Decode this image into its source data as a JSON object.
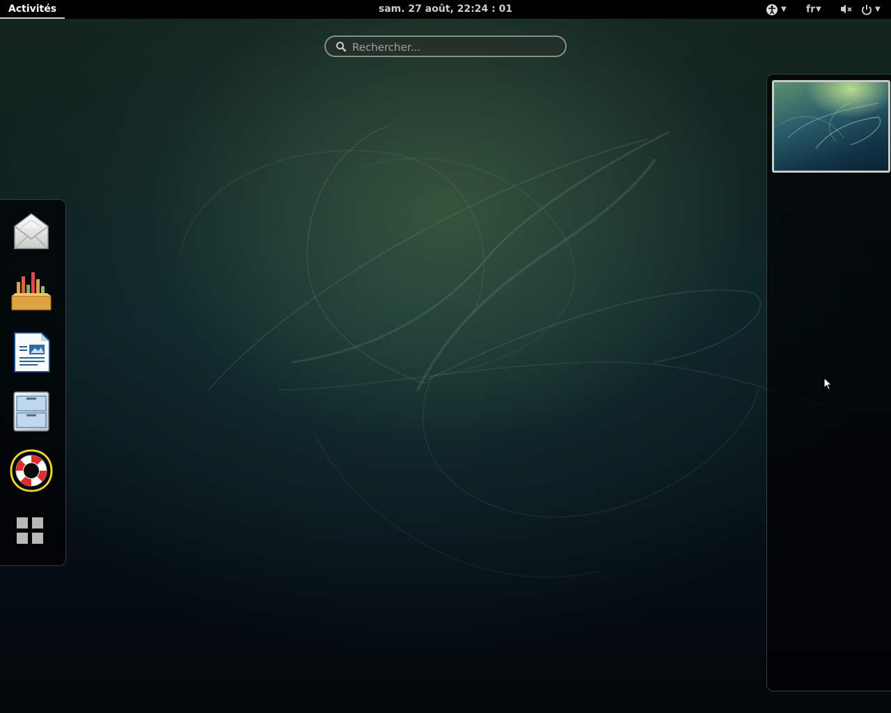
{
  "topbar": {
    "activities_label": "Activités",
    "clock": "sam. 27 août, 22:24 : 01",
    "language": "fr",
    "icons": [
      "accessibility-icon",
      "volume-muted-icon",
      "power-icon"
    ]
  },
  "search": {
    "placeholder": "Rechercher..."
  },
  "dash": {
    "items": [
      {
        "name": "mail-app-icon"
      },
      {
        "name": "sound-recorder-icon"
      },
      {
        "name": "writer-document-icon"
      },
      {
        "name": "file-cabinet-icon"
      },
      {
        "name": "help-lifebuoy-icon"
      },
      {
        "name": "show-applications-icon"
      }
    ]
  },
  "colors": {
    "topbar_bg": "#000000",
    "text": "#dddddd",
    "border": "#8a8f88"
  }
}
